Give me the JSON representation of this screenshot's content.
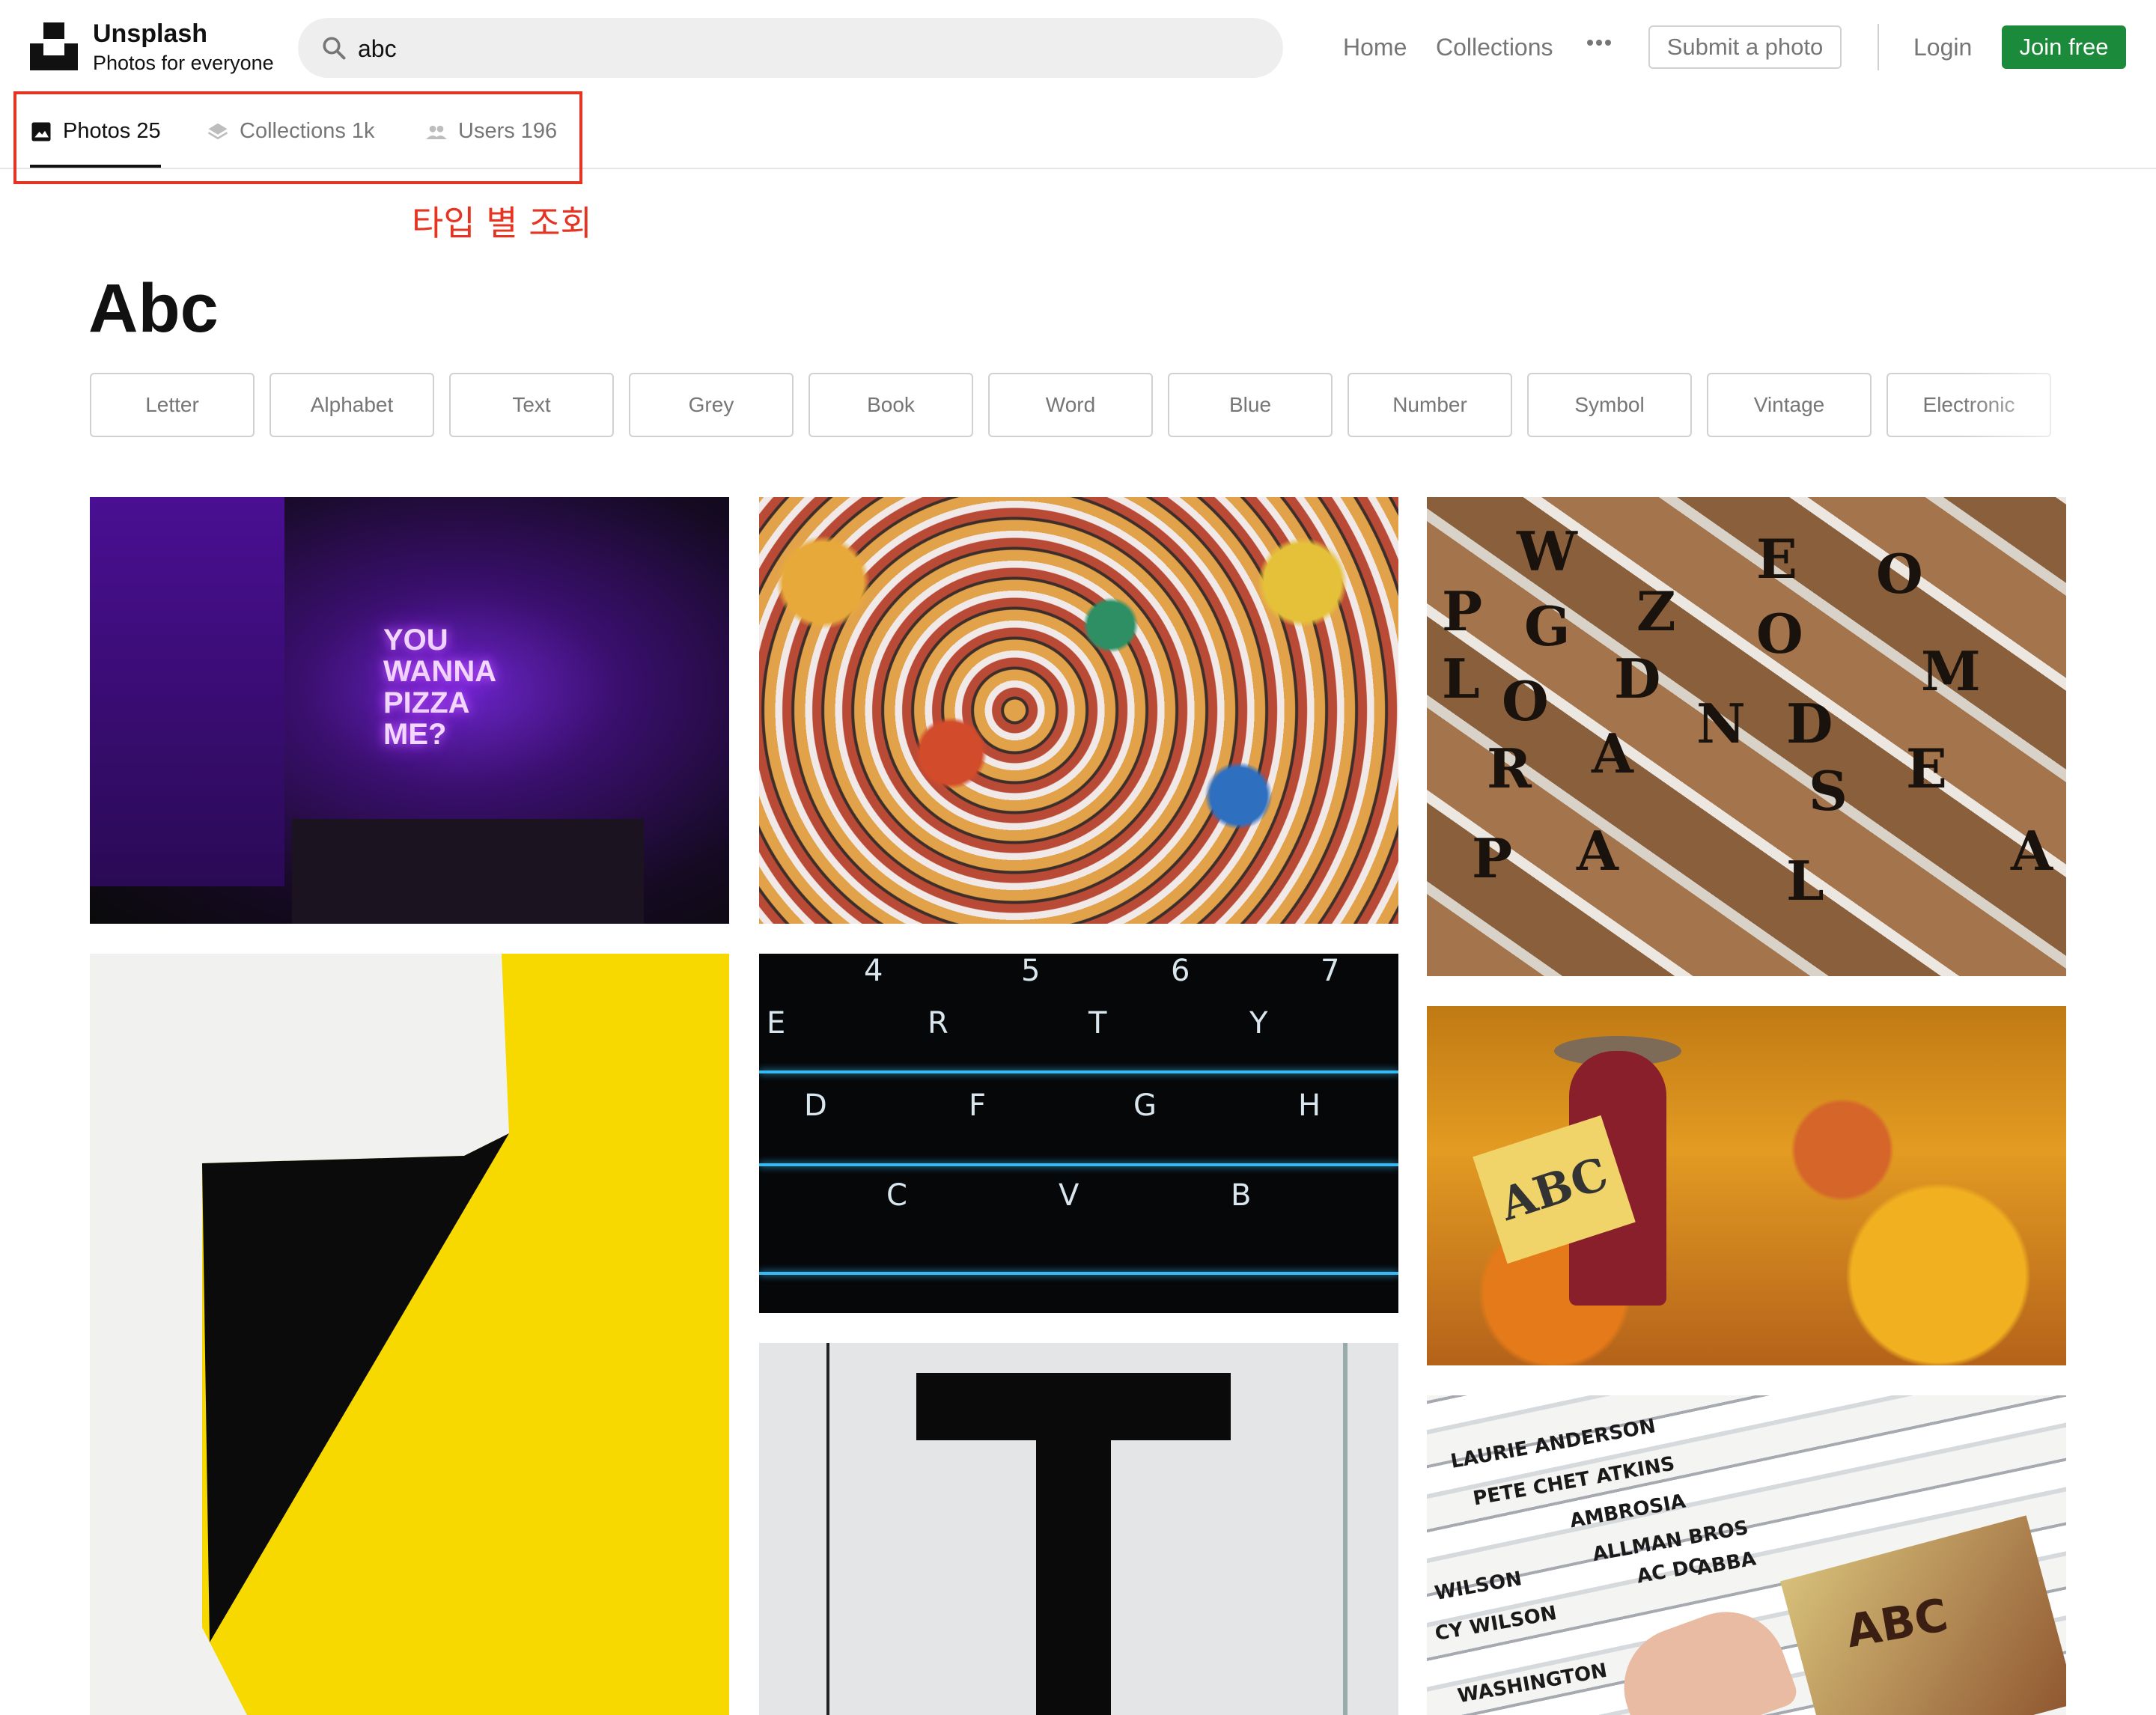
{
  "header": {
    "brand_name": "Unsplash",
    "brand_tagline": "Photos for everyone",
    "search_value": "abc",
    "nav": {
      "home": "Home",
      "collections": "Collections",
      "submit": "Submit a photo",
      "login": "Login",
      "join": "Join free"
    }
  },
  "tabs": [
    {
      "label": "Photos 25",
      "icon": "image-icon",
      "active": true
    },
    {
      "label": "Collections 1k",
      "icon": "collections-icon",
      "active": false
    },
    {
      "label": "Users 196",
      "icon": "users-icon",
      "active": false
    }
  ],
  "annotation": "타입 별 조회",
  "page_title": "Abc",
  "tags": [
    "Letter",
    "Alphabet",
    "Text",
    "Grey",
    "Book",
    "Word",
    "Blue",
    "Number",
    "Symbol",
    "Vintage",
    "Electronic"
  ],
  "photos": {
    "neon_sign": [
      "YOU",
      "WANNA",
      "PIZZA",
      "ME?"
    ],
    "tiles": [
      "W",
      "G",
      "Z",
      "E",
      "O",
      "P",
      "D",
      "O",
      "M",
      "L",
      "O",
      "N",
      "D",
      "R",
      "A",
      "S",
      "E",
      "P",
      "A",
      "L",
      "A"
    ],
    "keys": [
      "4",
      "5",
      "6",
      "7",
      "E",
      "R",
      "T",
      "Y",
      "D",
      "F",
      "G",
      "H",
      "C",
      "V",
      "B"
    ],
    "book_cover": "ABC",
    "record_labels": [
      "LAURIE ANDERSON",
      "PETE CHET ATKINS",
      "AMBROSIA",
      "ALLMAN BROS",
      "AC DC",
      "ABBA",
      "WILSON",
      "CY WILSON",
      "WASHINGTON",
      "ABC"
    ]
  },
  "colors": {
    "accent_green": "#1c8a3b",
    "annotation_red": "#e53422",
    "muted_text": "#767676"
  }
}
